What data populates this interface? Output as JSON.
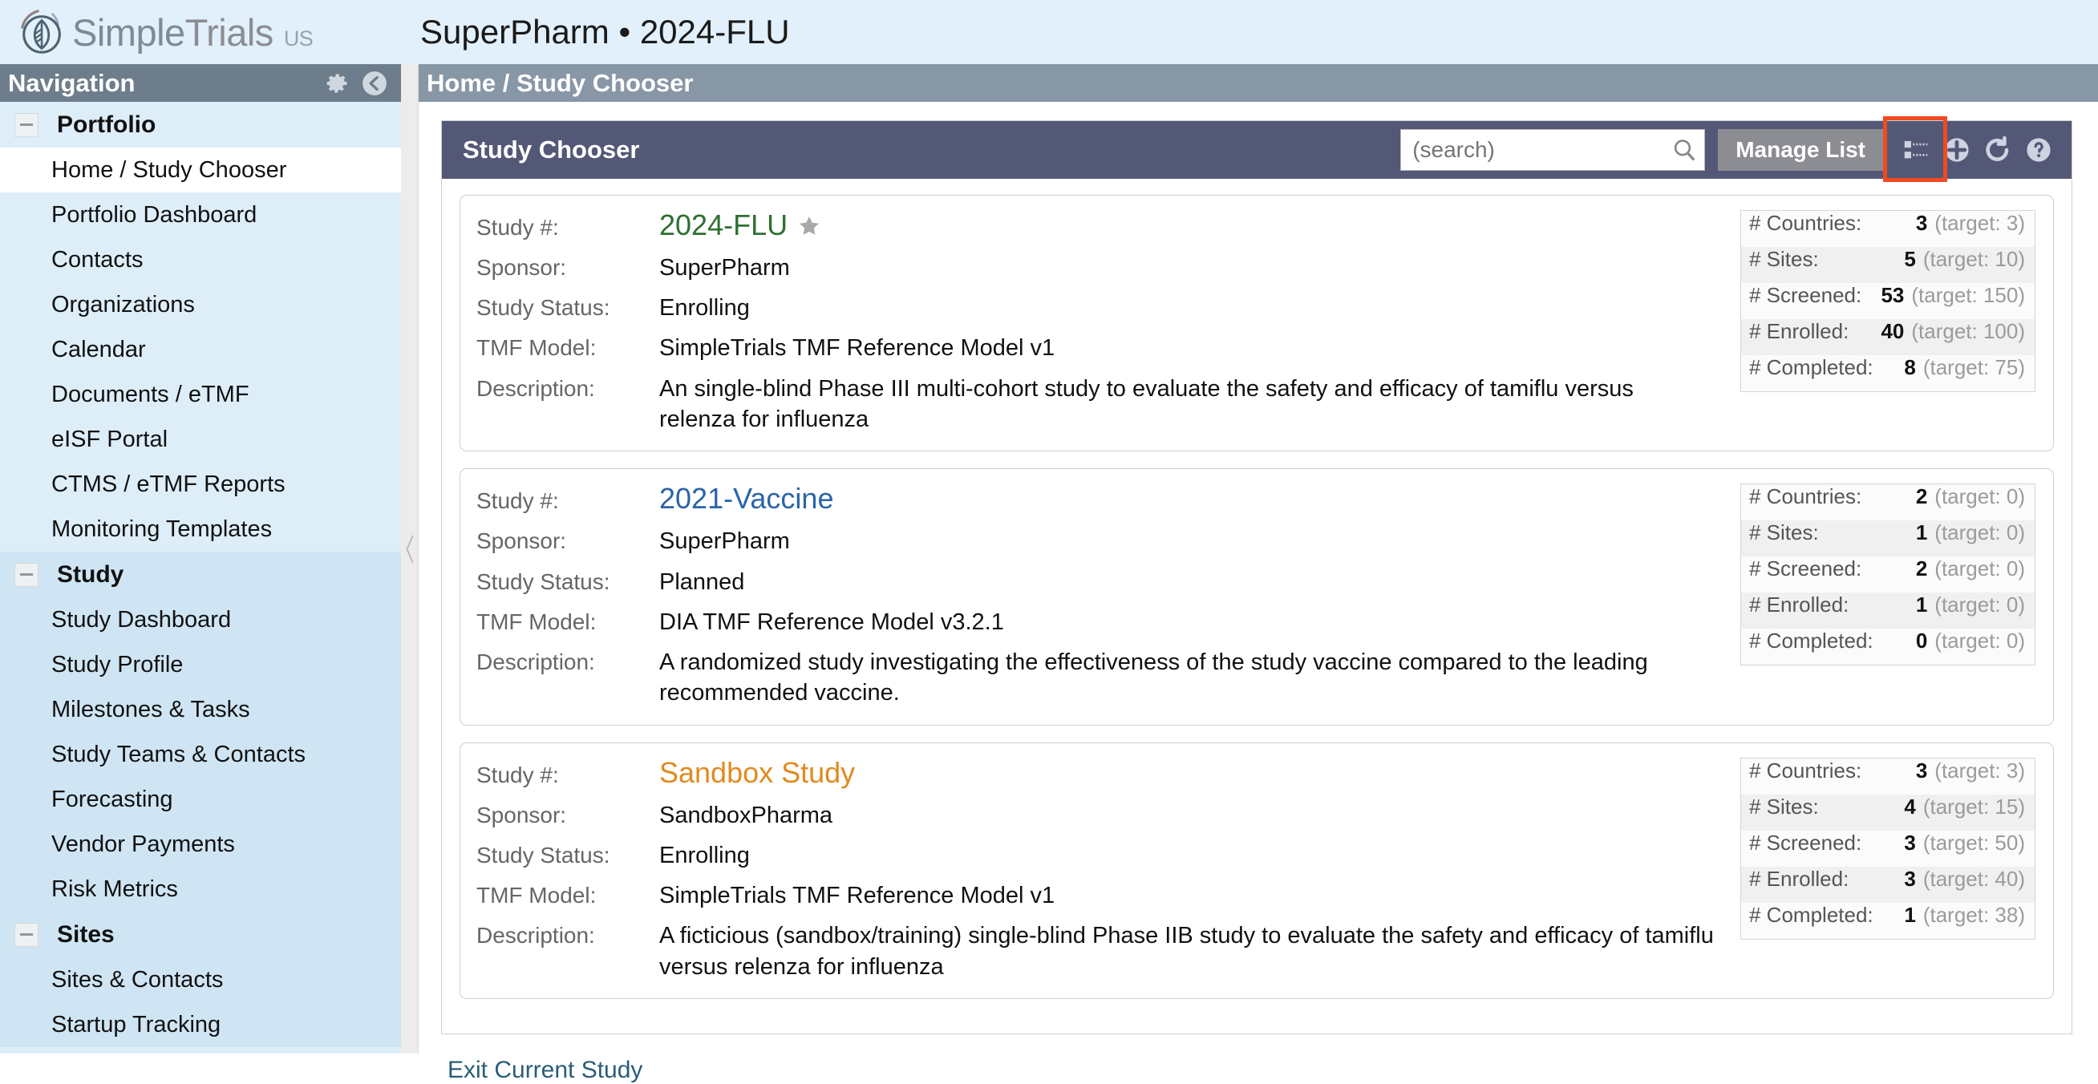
{
  "topbar": {
    "logo_simple": "Simple",
    "logo_trials": "Trials",
    "logo_region": "US",
    "app_title": "SuperPharm • 2024-FLU"
  },
  "sidebar": {
    "header_title": "Navigation",
    "gear_icon": "gear-icon",
    "collapse_icon": "collapse-left-icon",
    "groups": [
      {
        "label": "Portfolio",
        "items": [
          {
            "label": "Home / Study Chooser",
            "active": true
          },
          {
            "label": "Portfolio Dashboard",
            "active": false
          },
          {
            "label": "Contacts",
            "active": false
          },
          {
            "label": "Organizations",
            "active": false
          },
          {
            "label": "Calendar",
            "active": false
          },
          {
            "label": "Documents / eTMF",
            "active": false
          },
          {
            "label": "eISF Portal",
            "active": false
          },
          {
            "label": "CTMS / eTMF Reports",
            "active": false
          },
          {
            "label": "Monitoring Templates",
            "active": false
          }
        ]
      },
      {
        "label": "Study",
        "items": [
          {
            "label": "Study Dashboard",
            "active": false
          },
          {
            "label": "Study Profile",
            "active": false
          },
          {
            "label": "Milestones & Tasks",
            "active": false
          },
          {
            "label": "Study Teams & Contacts",
            "active": false
          },
          {
            "label": "Forecasting",
            "active": false
          },
          {
            "label": "Vendor Payments",
            "active": false
          },
          {
            "label": "Risk Metrics",
            "active": false
          }
        ]
      },
      {
        "label": "Sites",
        "items": [
          {
            "label": "Sites & Contacts",
            "active": false
          },
          {
            "label": "Startup Tracking",
            "active": false
          }
        ]
      }
    ]
  },
  "breadcrumb": "Home / Study Chooser",
  "panel": {
    "title": "Study Chooser",
    "search_placeholder": "(search)",
    "search_value": "",
    "search_icon": "search-icon",
    "manage_list_label": "Manage List",
    "toolbar_icons": [
      {
        "name": "detail-list-view-icon",
        "highlighted": true
      },
      {
        "name": "add-circle-icon",
        "highlighted": false
      },
      {
        "name": "refresh-icon",
        "highlighted": false
      },
      {
        "name": "help-circle-icon",
        "highlighted": false
      }
    ],
    "highlight_color": "#f04a20"
  },
  "labels": {
    "study_no": "Study #:",
    "sponsor": "Sponsor:",
    "study_status": "Study Status:",
    "tmf_model": "TMF Model:",
    "description": "Description:"
  },
  "metric_labels": {
    "countries": "# Countries:",
    "sites": "# Sites:",
    "screened": "# Screened:",
    "enrolled": "# Enrolled:",
    "completed": "# Completed:"
  },
  "studies": [
    {
      "study_no": "2024-FLU",
      "color": "#2e7031",
      "starred": true,
      "sponsor": "SuperPharm",
      "status": "Enrolling",
      "tmf_model": "SimpleTrials TMF Reference Model v1",
      "description": "An single-blind Phase III multi-cohort study to evaluate the safety and efficacy of tamiflu versus relenza for influenza",
      "metrics": [
        {
          "label": "# Countries:",
          "value": "3",
          "target": "(target: 3)"
        },
        {
          "label": "# Sites:",
          "value": "5",
          "target": "(target: 10)"
        },
        {
          "label": "# Screened:",
          "value": "53",
          "target": "(target: 150)"
        },
        {
          "label": "# Enrolled:",
          "value": "40",
          "target": "(target: 100)"
        },
        {
          "label": "# Completed:",
          "value": "8",
          "target": "(target: 75)"
        }
      ]
    },
    {
      "study_no": "2021-Vaccine",
      "color": "#2a64a8",
      "starred": false,
      "sponsor": "SuperPharm",
      "status": "Planned",
      "tmf_model": "DIA TMF Reference Model v3.2.1",
      "description": "A randomized study investigating the effectiveness of the study vaccine compared to the leading recommended vaccine.",
      "metrics": [
        {
          "label": "# Countries:",
          "value": "2",
          "target": "(target: 0)"
        },
        {
          "label": "# Sites:",
          "value": "1",
          "target": "(target: 0)"
        },
        {
          "label": "# Screened:",
          "value": "2",
          "target": "(target: 0)"
        },
        {
          "label": "# Enrolled:",
          "value": "1",
          "target": "(target: 0)"
        },
        {
          "label": "# Completed:",
          "value": "0",
          "target": "(target: 0)"
        }
      ]
    },
    {
      "study_no": "Sandbox Study",
      "color": "#e08a1e",
      "starred": false,
      "sponsor": "SandboxPharma",
      "status": "Enrolling",
      "tmf_model": "SimpleTrials TMF Reference Model v1",
      "description": "A ficticious (sandbox/training) single-blind Phase IIB study to evaluate the safety and efficacy of tamiflu versus relenza for influenza",
      "metrics": [
        {
          "label": "# Countries:",
          "value": "3",
          "target": "(target: 3)"
        },
        {
          "label": "# Sites:",
          "value": "4",
          "target": "(target: 15)"
        },
        {
          "label": "# Screened:",
          "value": "3",
          "target": "(target: 50)"
        },
        {
          "label": "# Enrolled:",
          "value": "3",
          "target": "(target: 40)"
        },
        {
          "label": "# Completed:",
          "value": "1",
          "target": "(target: 38)"
        }
      ]
    }
  ],
  "footer": {
    "exit_link": "Exit Current Study"
  }
}
